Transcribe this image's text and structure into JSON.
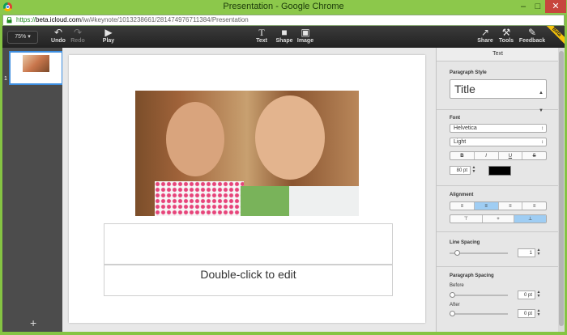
{
  "window": {
    "title": "Presentation - Google Chrome",
    "min": "–",
    "max": "□",
    "close": "✕"
  },
  "address": {
    "https": "https://",
    "host": "beta.icloud.com",
    "path": "/iw/#keynote/1013238661/281474976711384/Presentation"
  },
  "toolbar": {
    "zoom": "75% ▾",
    "undo": "Undo",
    "redo": "Redo",
    "play": "Play",
    "text": "Text",
    "shape": "Shape",
    "image": "Image",
    "share": "Share",
    "tools": "Tools",
    "feedback": "Feedback",
    "beta": "Beta"
  },
  "sidebar": {
    "slide_number": "1",
    "add": "+"
  },
  "slide": {
    "placeholder": "Double-click to edit"
  },
  "panel": {
    "tab": "Text",
    "paragraph_style": {
      "label": "Paragraph Style",
      "value": "Title"
    },
    "font": {
      "label": "Font",
      "family": "Helvetica",
      "weight": "Light",
      "bold": "B",
      "italic": "I",
      "underline": "U",
      "strike": "S",
      "size": "80 pt",
      "color": "#000000"
    },
    "alignment": {
      "label": "Alignment"
    },
    "line_spacing": {
      "label": "Line Spacing",
      "value": "1"
    },
    "paragraph_spacing": {
      "label": "Paragraph Spacing",
      "before_label": "Before",
      "before_value": "0 pt",
      "after_label": "After",
      "after_value": "0 pt"
    }
  }
}
